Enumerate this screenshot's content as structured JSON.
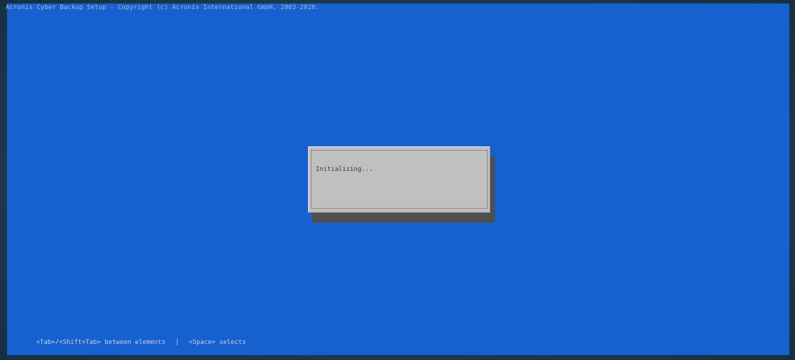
{
  "header": {
    "title": "Acronis Cyber Backup Setup - Copyright (c) Acronis International GmbH, 2003-2020."
  },
  "dialog": {
    "message": "Initializing..."
  },
  "status_bar": {
    "hint_navigation": "<Tab>/<Shift+Tab> between elements",
    "separator": "|",
    "hint_select": "<Space> selects"
  },
  "colors": {
    "background": "#1760d0",
    "dialog": "#c0c0c0",
    "shadow": "#4f4f4f"
  }
}
